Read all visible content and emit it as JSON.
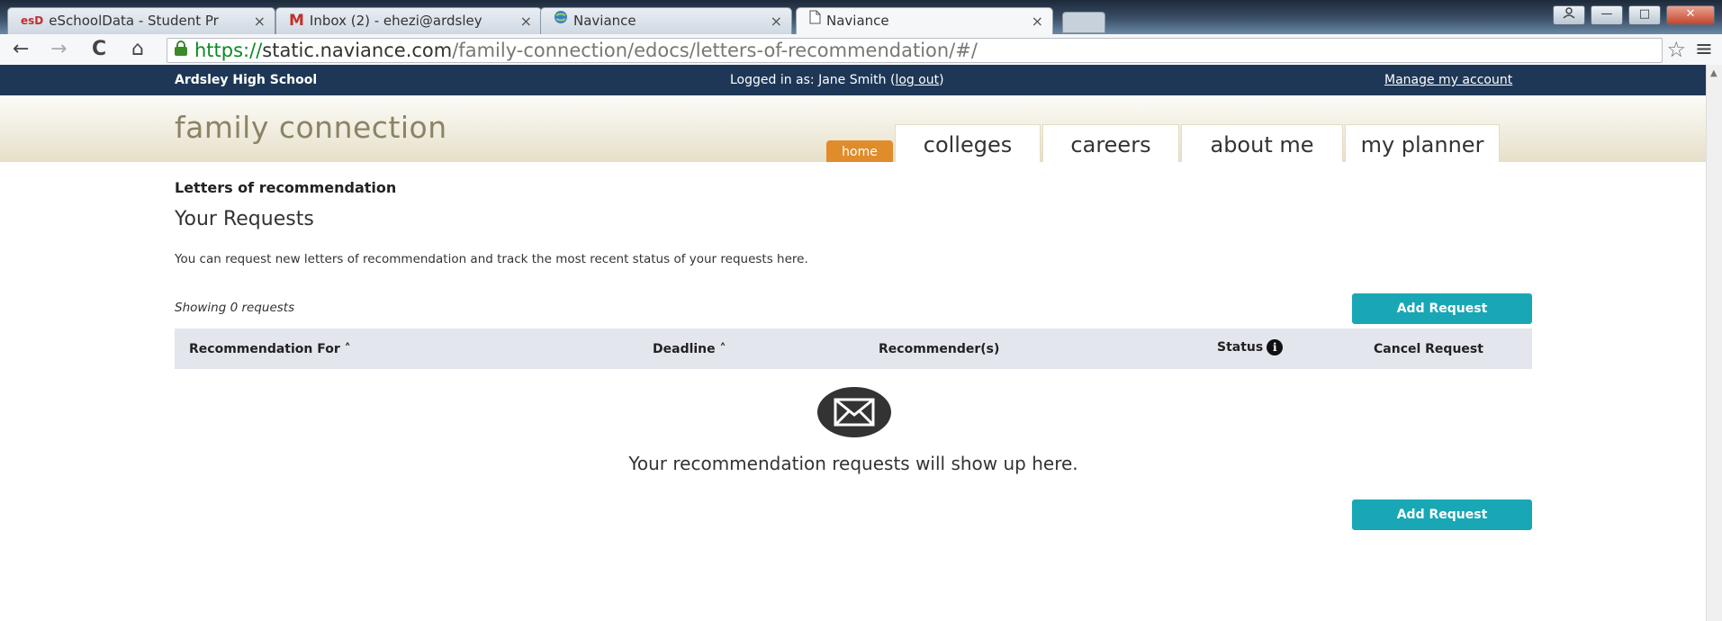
{
  "browser": {
    "tabs": [
      {
        "label": "eSchoolData - Student Pr",
        "favicon": "esD",
        "active": false
      },
      {
        "label": "Inbox (2) - ehezi@ardsley",
        "favicon": "M",
        "active": false
      },
      {
        "label": "Naviance",
        "favicon": "globe-icon",
        "active": false
      },
      {
        "label": "Naviance",
        "favicon": "page-icon",
        "active": true
      }
    ],
    "tab_close": "×",
    "url_scheme": "https://",
    "url_host": "static.naviance.com",
    "url_path": "/family-connection/edocs/letters-of-recommendation/#/",
    "nav": {
      "back": "←",
      "forward": "→",
      "reload": "C",
      "home": "⌂"
    },
    "star": "☆",
    "menu": "≡",
    "window_buttons": {
      "minimize": "—",
      "maximize": "□",
      "close": "✕"
    }
  },
  "topbar": {
    "school": "Ardsley High School",
    "logged_prefix": "Logged in as: Jane Smith (",
    "logout": "log out",
    "logged_suffix": ")",
    "manage": "Manage my account"
  },
  "header": {
    "brand": "family connection",
    "home_tab": "home",
    "tabs": [
      "colleges",
      "careers",
      "about me",
      "my planner"
    ]
  },
  "main": {
    "breadcrumb": "Letters of recommendation",
    "title": "Your Requests",
    "description": "You can request new letters of recommendation and track the most recent status of your requests here.",
    "showing": "Showing 0 requests",
    "add_button": "Add Request",
    "columns": {
      "recommendation_for": "Recommendation For",
      "deadline": "Deadline",
      "recommenders": "Recommender(s)",
      "status": "Status",
      "cancel": "Cancel Request"
    },
    "sort_glyph": "˄",
    "info_glyph": "i",
    "empty_message": "Your recommendation requests will show up here."
  },
  "colors": {
    "topbar": "#1e3756",
    "home_tab": "#e08c2a",
    "button": "#19a7b5",
    "table_header": "#e4e6ee"
  }
}
